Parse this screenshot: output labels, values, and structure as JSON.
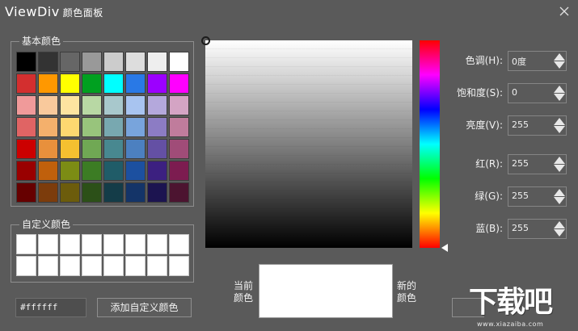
{
  "window": {
    "brand": "ViewDiv",
    "subtitle": "颜色面板"
  },
  "basic_colors": {
    "legend": "基本颜色",
    "swatches": [
      "#000000",
      "#333333",
      "#666666",
      "#999999",
      "#cccccc",
      "#dddddd",
      "#eeeeee",
      "#ffffff",
      "#d32f2f",
      "#ff9800",
      "#ffff00",
      "#00a020",
      "#00ffff",
      "#2979e6",
      "#9c00ff",
      "#ff00ff",
      "#f09a9a",
      "#f9c99c",
      "#fde4a0",
      "#b8d8a4",
      "#a8c8cc",
      "#a8c4f0",
      "#b4a8dc",
      "#d4a4c4",
      "#e06464",
      "#f4b06c",
      "#fdd870",
      "#98c47c",
      "#78a8b0",
      "#78a4dc",
      "#8c7cc4",
      "#c07c9c",
      "#cc0000",
      "#e8903c",
      "#f4c030",
      "#70a854",
      "#488890",
      "#4c80c0",
      "#6450a4",
      "#a04c78",
      "#990000",
      "#c0600c",
      "#7c8c14",
      "#3c7c24",
      "#205c68",
      "#1c50a0",
      "#3c2080",
      "#7c1c50",
      "#660000",
      "#7c3c0c",
      "#6c5c0c",
      "#2c5018",
      "#143c48",
      "#143468",
      "#1c1450",
      "#4c1430"
    ]
  },
  "custom_colors": {
    "legend": "自定义颜色",
    "count": 16
  },
  "hex_value": "#ffffff",
  "add_custom_label": "添加自定义颜色",
  "fields": {
    "hue": {
      "label": "色调(H):",
      "value": "0度"
    },
    "saturation": {
      "label": "饱和度(S):",
      "value": "0"
    },
    "brightness": {
      "label": "亮度(V):",
      "value": "255"
    },
    "red": {
      "label": "红(R):",
      "value": "255"
    },
    "green": {
      "label": "绿(G):",
      "value": "255"
    },
    "blue": {
      "label": "蓝(B):",
      "value": "255"
    }
  },
  "preview": {
    "current_label": "当前\n颜色",
    "new_label": "新的\n颜色",
    "color": "#ffffff"
  },
  "watermark": {
    "text": "下载吧",
    "url": "www.xiazaiba.com"
  },
  "colors": {
    "background": "#5a5a5a",
    "border": "#8e8e8e"
  }
}
